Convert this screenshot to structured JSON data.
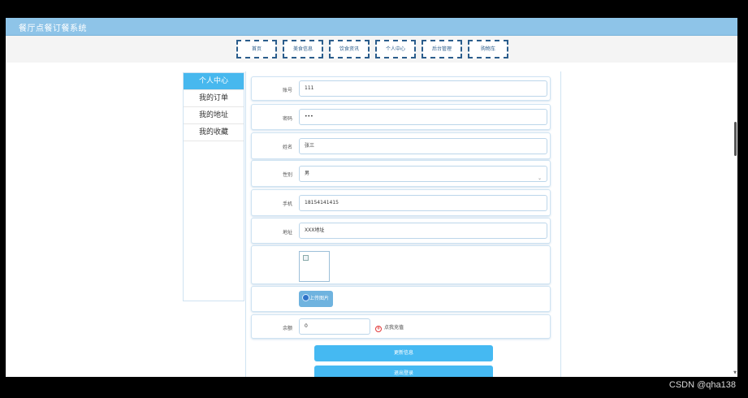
{
  "app": {
    "title": "餐厅点餐订餐系统"
  },
  "nav": {
    "items": [
      {
        "label": "首页"
      },
      {
        "label": "美食信息"
      },
      {
        "label": "饮食资讯"
      },
      {
        "label": "个人中心"
      },
      {
        "label": "后台管理"
      },
      {
        "label": "购物车"
      }
    ]
  },
  "sidebar": {
    "items": [
      {
        "label": "个人中心",
        "active": true
      },
      {
        "label": "我的订单"
      },
      {
        "label": "我的地址"
      },
      {
        "label": "我的收藏"
      }
    ]
  },
  "form": {
    "account": {
      "label": "账号",
      "value": "111"
    },
    "password": {
      "label": "密码",
      "value": "•••"
    },
    "name": {
      "label": "姓名",
      "value": "张三"
    },
    "gender": {
      "label": "性别",
      "value": "男"
    },
    "phone": {
      "label": "手机",
      "value": "18154141415"
    },
    "address": {
      "label": "地址",
      "value": "XXX地址"
    },
    "upload_label": "上传图片",
    "balance": {
      "label": "余额",
      "value": "0"
    },
    "recharge_icon": "¥",
    "recharge_label": "点我充值"
  },
  "actions": {
    "update_label": "更新信息",
    "logout_label": "退出登录"
  },
  "watermark": "CSDN @qha138",
  "icons": {
    "upload": "upload-icon",
    "recharge": "yen-circle-icon",
    "dropdown": "chevron-down-icon",
    "broken_image": "broken-image-icon"
  },
  "colors": {
    "header": "#8ec4e8",
    "accent": "#45b9f2",
    "sidebar_active": "#47b8ee",
    "nav_border": "#2b5d8c"
  }
}
